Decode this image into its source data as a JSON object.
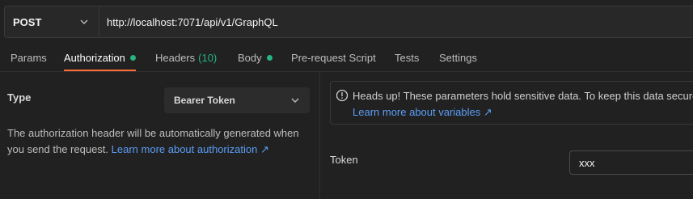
{
  "request": {
    "method": "POST",
    "url": "http://localhost:7071/api/v1/GraphQL"
  },
  "tabs": [
    {
      "label": "Params"
    },
    {
      "label": "Authorization",
      "active": true,
      "indicator": "green-dot"
    },
    {
      "label": "Headers",
      "count": "(10)"
    },
    {
      "label": "Body",
      "indicator": "green-dot"
    },
    {
      "label": "Pre-request Script"
    },
    {
      "label": "Tests"
    },
    {
      "label": "Settings"
    }
  ],
  "auth": {
    "type_label": "Type",
    "type_value": "Bearer Token",
    "description": "The authorization header will be automatically generated when you send the request.",
    "learn_link": "Learn more about authorization ↗"
  },
  "notice": {
    "text": "Heads up! These parameters hold sensitive data. To keep this data secure",
    "link": "Learn more about variables ↗"
  },
  "token": {
    "label": "Token",
    "value": "xxx"
  },
  "colors": {
    "accent": "#ff6c37",
    "success": "#26b47f",
    "link": "#5b9df5"
  }
}
